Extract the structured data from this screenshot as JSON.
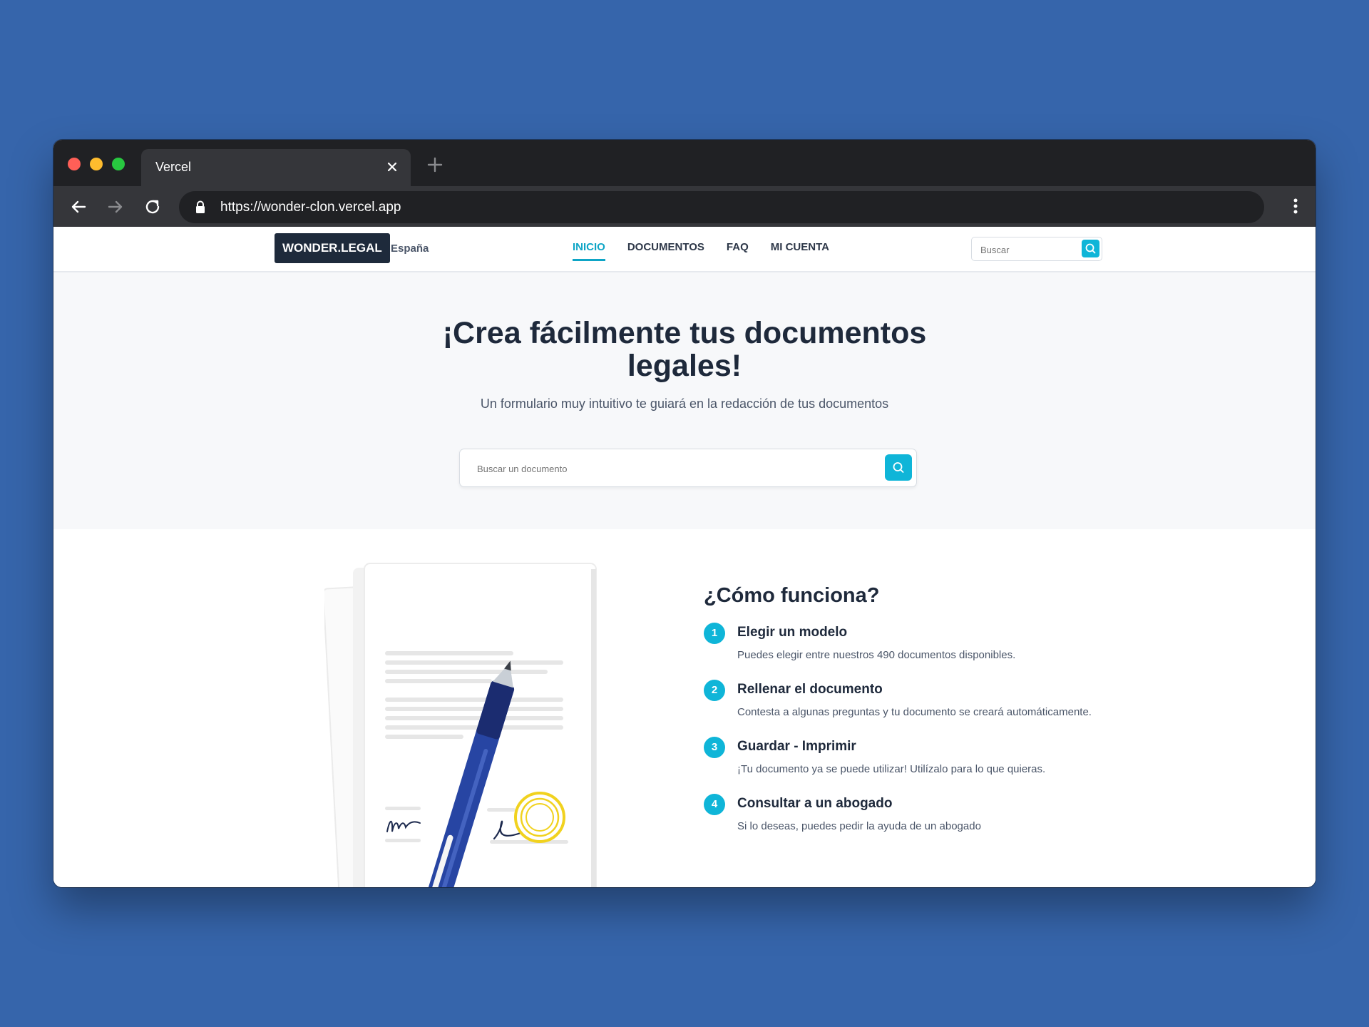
{
  "browser": {
    "tab_title": "Vercel",
    "url": "https://wonder-clon.vercel.app"
  },
  "header": {
    "logo": "WONDER.LEGAL",
    "country": "España",
    "nav": [
      "INICIO",
      "DOCUMENTOS",
      "FAQ",
      "MI CUENTA"
    ],
    "search_placeholder": "Buscar"
  },
  "hero": {
    "title": "¡Crea fácilmente tus documentos legales!",
    "subtitle": "Un formulario muy intuitivo te guiará en la redacción de tus documentos",
    "search_placeholder": "Buscar un documento"
  },
  "how": {
    "title": "¿Cómo funciona?",
    "steps": [
      {
        "num": "1",
        "title": "Elegir un modelo",
        "desc": "Puedes elegir entre nuestros 490 documentos disponibles."
      },
      {
        "num": "2",
        "title": "Rellenar el documento",
        "desc": "Contesta a algunas preguntas y tu documento se creará automáticamente."
      },
      {
        "num": "3",
        "title": "Guardar - Imprimir",
        "desc": "¡Tu documento ya se puede utilizar! Utilízalo para lo que quieras."
      },
      {
        "num": "4",
        "title": "Consultar a un abogado",
        "desc": "Si lo deseas, puedes pedir la ayuda de un abogado"
      }
    ]
  },
  "colors": {
    "background": "#3665ab",
    "accent": "#0fb5d8",
    "logo_bg": "#1e2a3b",
    "heading": "#1e293b"
  },
  "icons": [
    "close-icon",
    "plus-icon",
    "back-arrow-icon",
    "forward-arrow-icon",
    "reload-icon",
    "lock-icon",
    "kebab-menu-icon",
    "search-icon"
  ]
}
